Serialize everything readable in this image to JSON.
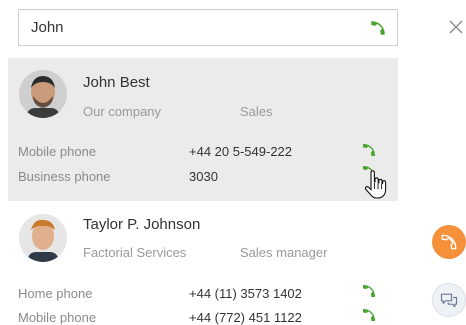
{
  "search": {
    "value": "John",
    "call_icon": "phone-icon"
  },
  "close_icon": "close-icon",
  "colors": {
    "accent_green": "#4aa52e",
    "accent_orange": "#f5913a",
    "selected_bg": "#ebebeb"
  },
  "contacts": [
    {
      "name": "John Best",
      "company": "Our company",
      "position": "Sales",
      "phones": [
        {
          "label": "Mobile phone",
          "number": "+44 20 5-549-222"
        },
        {
          "label": "Business phone",
          "number": "3030"
        }
      ]
    },
    {
      "name": "Taylor P. Johnson",
      "company": "Factorial Services",
      "position": "Sales manager",
      "phones": [
        {
          "label": "Home phone",
          "number": "+44 (11) 3573 1402"
        },
        {
          "label": "Mobile phone",
          "number": "+44 (772) 451 1122"
        }
      ]
    }
  ],
  "side_buttons": [
    {
      "icon": "phone-icon"
    },
    {
      "icon": "chat-icon"
    }
  ]
}
